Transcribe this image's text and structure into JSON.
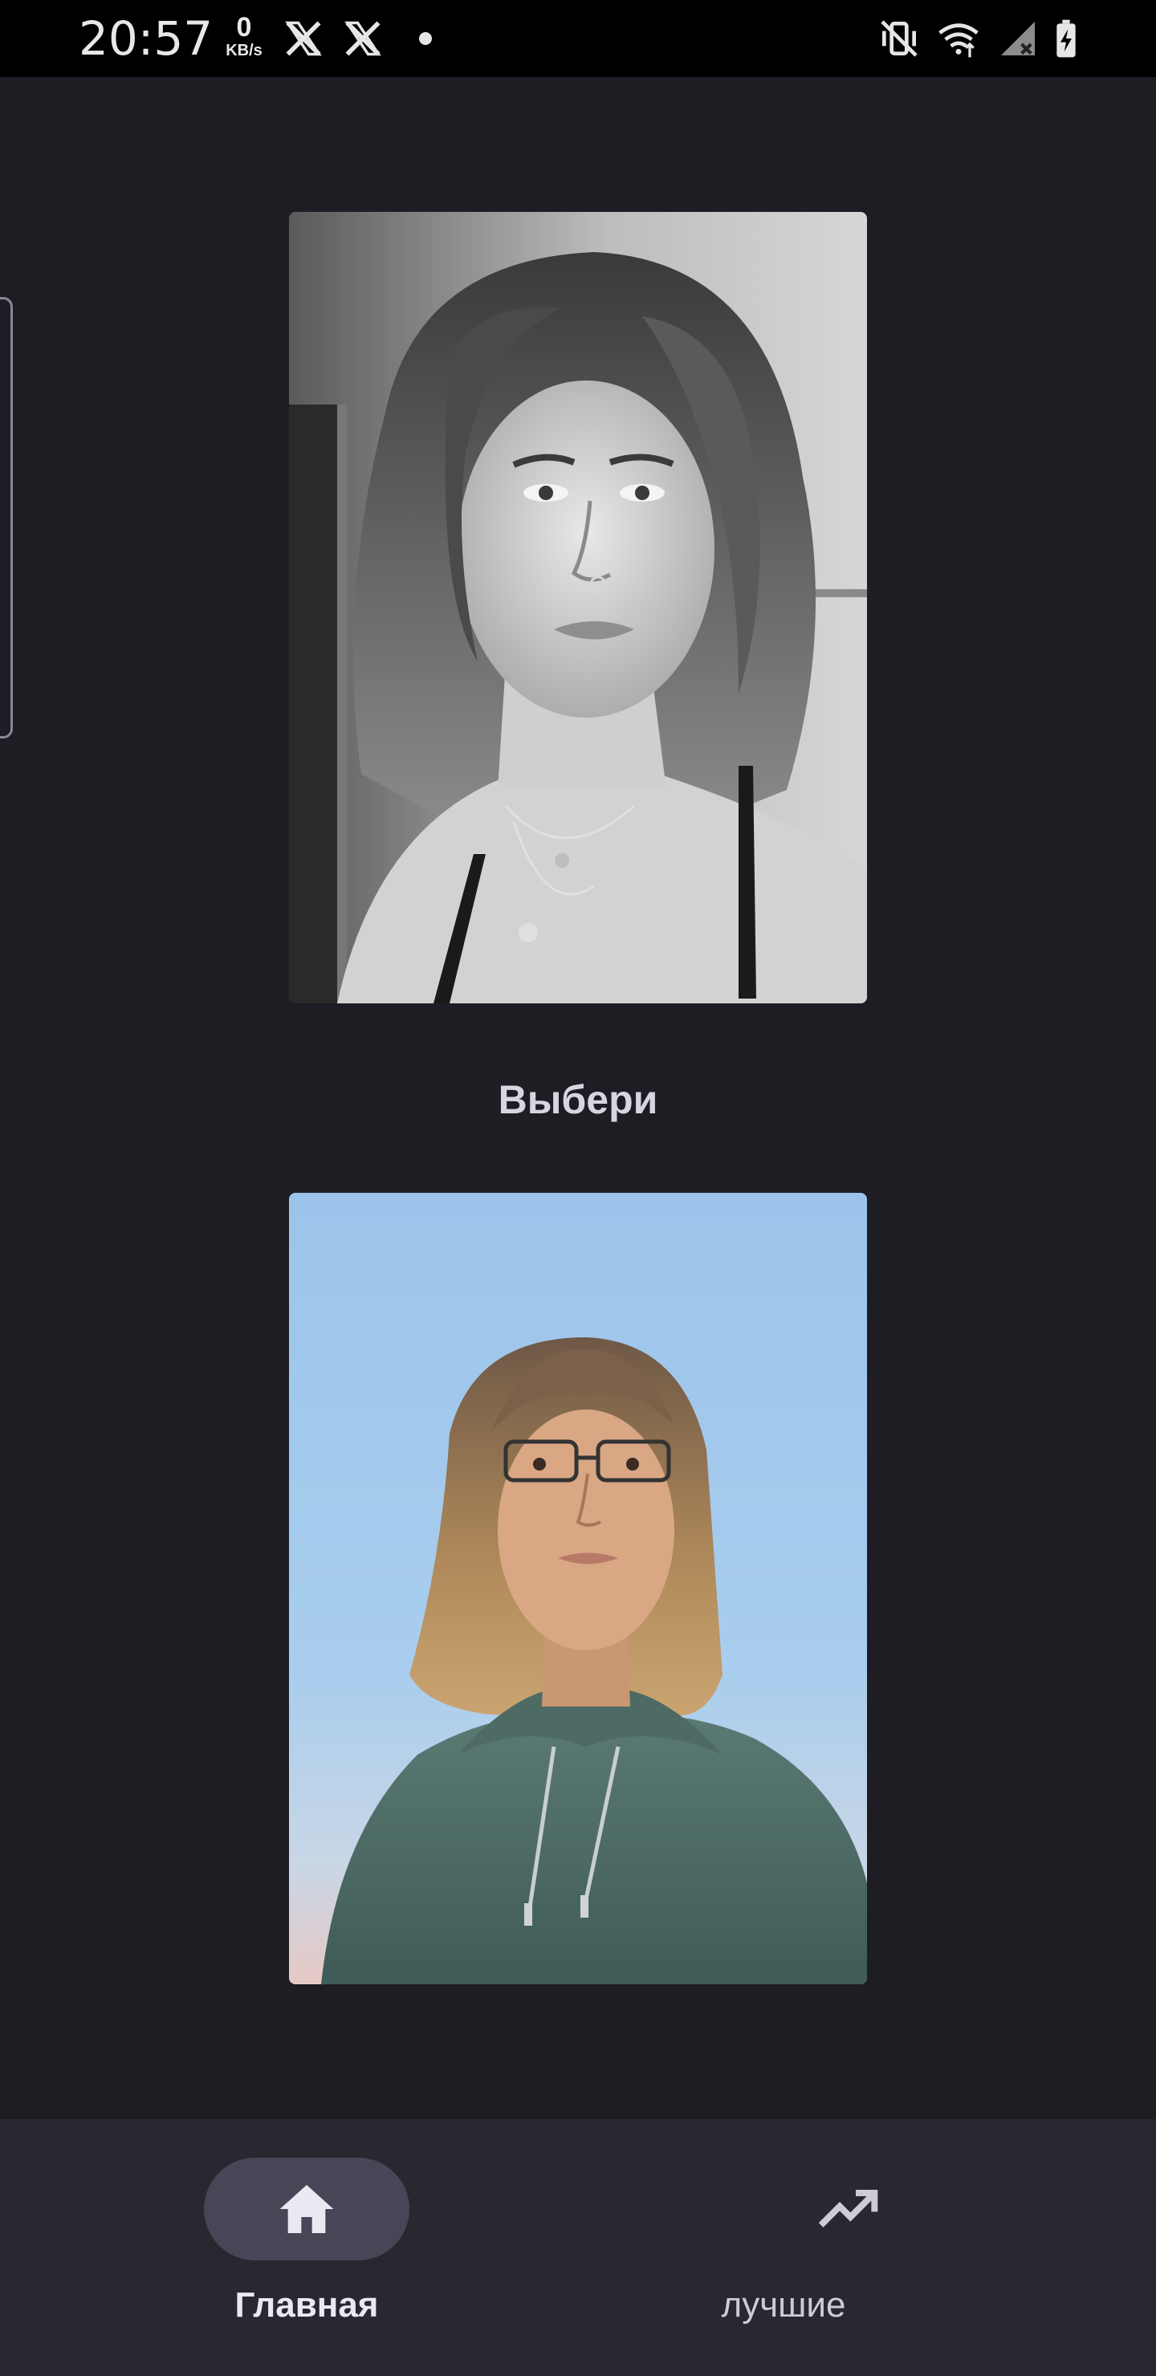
{
  "status_bar": {
    "time": "20:57",
    "speed_value": "0",
    "speed_unit": "KB/s",
    "notification_icons": [
      "x-icon",
      "x-icon",
      "dot-icon"
    ],
    "system_icons": [
      "vibrate-mute-icon",
      "wifi-icon",
      "signal-icon",
      "battery-charging-icon"
    ]
  },
  "main": {
    "title": "Выбери",
    "photos": [
      {
        "name": "photo-option-top",
        "style": "black-and-white portrait"
      },
      {
        "name": "photo-option-bottom",
        "style": "color portrait, sky background"
      }
    ]
  },
  "bottom_nav": {
    "items": [
      {
        "label": "Главная",
        "icon": "home-icon",
        "active": true
      },
      {
        "label": "лучшие",
        "icon": "trending-up-icon",
        "active": false
      }
    ]
  },
  "colors": {
    "background": "#1e1d24",
    "nav_background": "#29272f",
    "active_pill": "#4a4556",
    "title_text": "#d9d5e0"
  }
}
